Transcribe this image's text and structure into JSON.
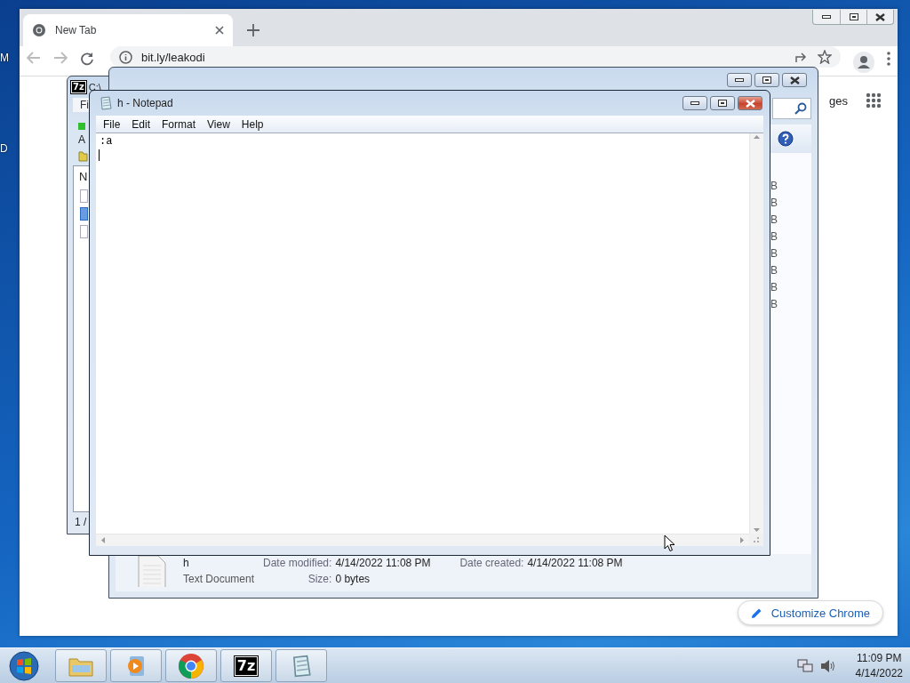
{
  "desktop": {
    "edge_labels": [
      "M",
      "D"
    ]
  },
  "chrome": {
    "tabs": [
      {
        "title": "New Tab",
        "selected": true
      }
    ],
    "address": "bit.ly/leakodi",
    "partial_link": "ges",
    "customize_button": "Customize Chrome"
  },
  "sevenzip": {
    "icon_label": "7z",
    "title": "C:\\",
    "menu": [
      "Fi"
    ],
    "toolbar_label": "A",
    "column_header": "N",
    "rows": [
      {
        "selected": false
      },
      {
        "selected": true
      },
      {
        "selected": false
      }
    ],
    "status": "1 /"
  },
  "explorer": {
    "size_column": [
      "B",
      "B",
      "B",
      "B",
      "B",
      "B",
      "B",
      "B"
    ],
    "details": {
      "name": "h",
      "type": "Text Document",
      "fields": [
        {
          "label": "Date modified:",
          "value": "4/14/2022 11:08 PM"
        },
        {
          "label": "Date created:",
          "value": "4/14/2022 11:08 PM"
        },
        {
          "label": "Size:",
          "value": "0 bytes"
        }
      ]
    }
  },
  "notepad": {
    "title": "h - Notepad",
    "menu": [
      "File",
      "Edit",
      "Format",
      "View",
      "Help"
    ],
    "text": ":a"
  },
  "taskbar": {
    "apps": [
      {
        "kind": "explorer"
      },
      {
        "kind": "media"
      },
      {
        "kind": "chrome"
      },
      {
        "kind": "sevenzip",
        "label": "7z"
      },
      {
        "kind": "notepad"
      }
    ],
    "time": "11:09 PM",
    "date": "4/14/2022"
  }
}
